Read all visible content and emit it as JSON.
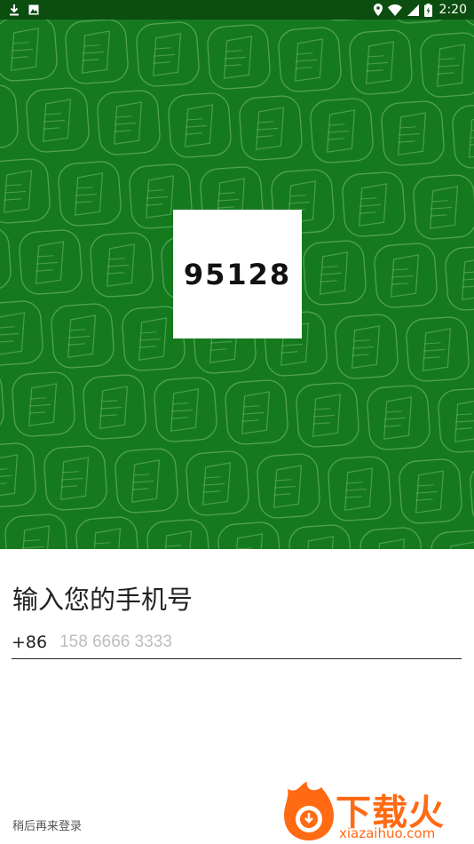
{
  "status_bar": {
    "time": "2:20",
    "left_icons": [
      "download-icon",
      "image-notification-icon"
    ],
    "right_icons": [
      "location-icon",
      "wifi-icon",
      "signal-icon",
      "battery-icon"
    ]
  },
  "hero": {
    "background_color": "#157a1e",
    "logo_text": "95128"
  },
  "form": {
    "title": "输入您的手机号",
    "country_code": "+86",
    "phone_value": "",
    "phone_placeholder": "158 6666 3333"
  },
  "footer": {
    "later_login": "稍后再来登录"
  },
  "watermark": {
    "cn": "下载火",
    "en": "xiazaihuo.com"
  }
}
